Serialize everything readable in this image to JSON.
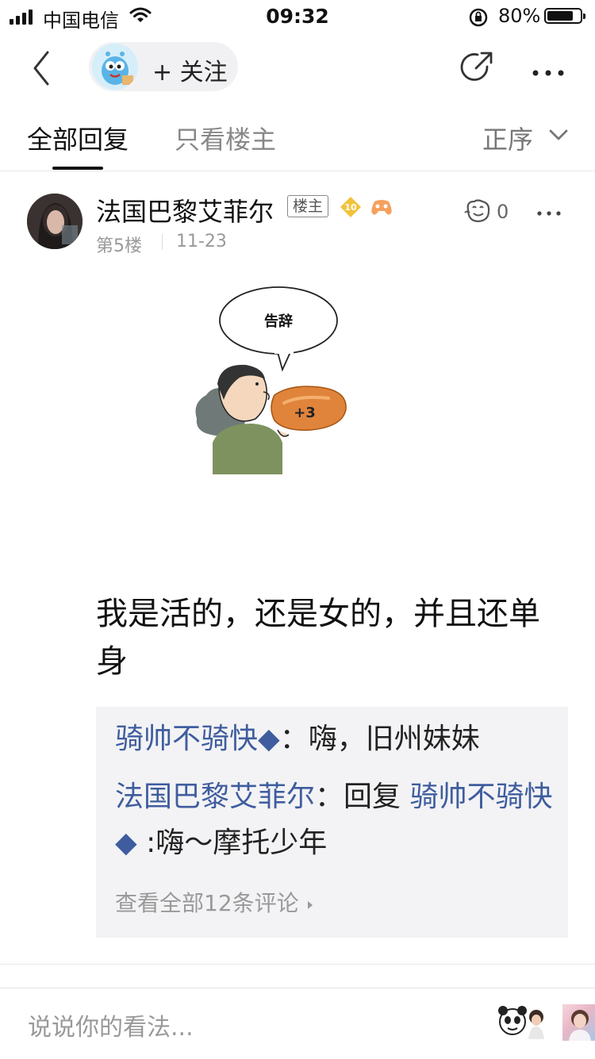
{
  "status_bar": {
    "carrier": "中国电信",
    "time": "09:32",
    "battery_text": "80%",
    "battery_level": 0.8
  },
  "header": {
    "follow_label": "+ 关注",
    "icons": [
      "back-icon",
      "share-icon",
      "more-icon"
    ]
  },
  "tabs": {
    "all_replies": "全部回复",
    "only_op": "只看楼主",
    "order_label": "正序"
  },
  "post": {
    "username": "法国巴黎艾菲尔",
    "op_badge": "楼主",
    "level": "10",
    "floor": "第5楼",
    "date": "11-23",
    "like_count": "0",
    "meme": {
      "bubble_text": "告辞",
      "badge_text": "+3"
    },
    "content": "我是活的，还是女的，并且还单身"
  },
  "replies": {
    "items": [
      {
        "author": "骑帅不骑快◆",
        "sep": "：",
        "text": "嗨，旧州妹妹"
      },
      {
        "author": "法国巴黎艾菲尔",
        "sep": "：",
        "reply_prefix": "回复 ",
        "reply_to": "骑帅不骑快◆",
        "text": " :嗨～摩托少年"
      }
    ],
    "see_all": "查看全部12条评论"
  },
  "bottom_bar": {
    "placeholder": "说说你的看法..."
  },
  "colors": {
    "link_blue": "#3f5d9e",
    "muted_gray": "#999999",
    "reply_bg": "#f3f3f5"
  }
}
